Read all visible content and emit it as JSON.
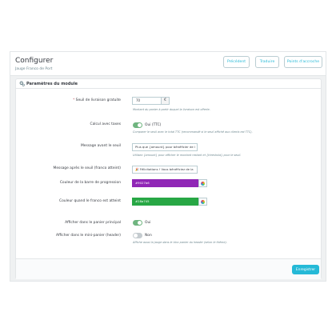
{
  "header": {
    "title": "Configurer",
    "subtitle": "Jauge Franco de Port",
    "buttons": [
      "Précédent",
      "Traduire",
      "Points d'accroche"
    ]
  },
  "card": {
    "title": "Paramètres du module",
    "fields": {
      "threshold": {
        "label": "Seuil de livraison gratuite",
        "required_mark": "*",
        "value": "70",
        "suffix": "€",
        "help": "Montant du panier à partir duquel la livraison est offerte."
      },
      "taxes": {
        "label": "Calcul avec taxes",
        "state": "Oui (TTC)",
        "on": true,
        "help": "Comparer le seuil avec le total TTC (recommandé si le seuil affiché aux clients est TTC)."
      },
      "before_msg": {
        "label": "Message avant le seuil",
        "value": "Plus que {amount} pour bénéficier de l",
        "help": "Utilisez {amount} pour afficher le montant restant et {threshold} pour le seuil."
      },
      "after_msg": {
        "label": "Message après le seuil (franco atteint)",
        "value": "🎉 Félicitations ! Vous bénéficiez de la"
      },
      "bar_color": {
        "label": "Couleur de la barre de progression",
        "value": "#9027b6",
        "hex": "#9027b6"
      },
      "reached_color": {
        "label": "Couleur quand le franco est atteint",
        "value": "#28a745",
        "hex": "#28a745"
      },
      "main_cart": {
        "label": "Afficher dans le panier principal",
        "state": "Oui",
        "on": true
      },
      "mini_cart": {
        "label": "Afficher dans le mini-panier (header)",
        "state": "Non",
        "on": false,
        "help": "Affiche aussi la jauge dans le bloc panier du header (selon le thème)."
      }
    },
    "save_label": "Enregistrer"
  },
  "colors": {
    "accent": "#25b9d7",
    "toggle_on": "#70b580",
    "toggle_off": "#c5ccd0"
  }
}
